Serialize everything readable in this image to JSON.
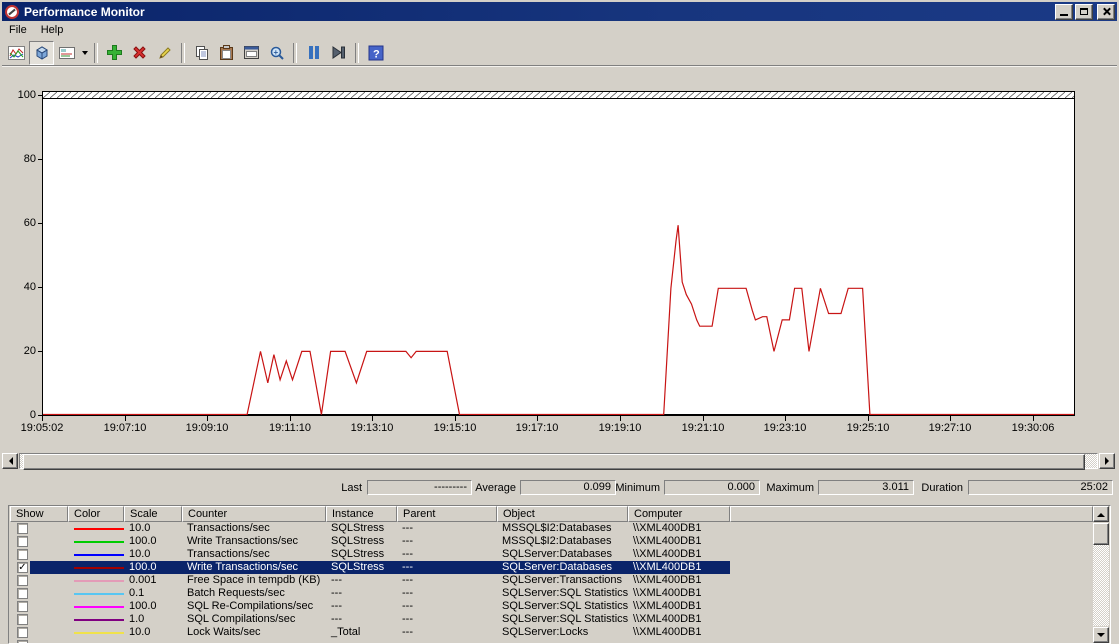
{
  "window": {
    "title": "Performance Monitor",
    "controls": {
      "minimize": "minimize",
      "maximize": "maximize",
      "close": "close"
    }
  },
  "menu": {
    "items": [
      {
        "label": "File"
      },
      {
        "label": "Help"
      }
    ]
  },
  "toolbar": {
    "items": [
      {
        "type": "button",
        "name": "view-current-activity",
        "icon": "chart"
      },
      {
        "type": "button",
        "name": "view-log-data",
        "icon": "cube",
        "pressed": true
      },
      {
        "type": "button",
        "name": "view-report",
        "icon": "report",
        "dropdown": true
      },
      {
        "type": "separator"
      },
      {
        "type": "button",
        "name": "add-counter",
        "icon": "add"
      },
      {
        "type": "button",
        "name": "delete-counter",
        "icon": "delete"
      },
      {
        "type": "button",
        "name": "highlight",
        "icon": "highlight"
      },
      {
        "type": "separator"
      },
      {
        "type": "button",
        "name": "copy-properties",
        "icon": "copy"
      },
      {
        "type": "button",
        "name": "paste-counter-list",
        "icon": "paste"
      },
      {
        "type": "button",
        "name": "properties",
        "icon": "properties"
      },
      {
        "type": "button",
        "name": "zoom",
        "icon": "zoom"
      },
      {
        "type": "separator"
      },
      {
        "type": "button",
        "name": "freeze-display",
        "icon": "pause"
      },
      {
        "type": "button",
        "name": "update-data",
        "icon": "step"
      },
      {
        "type": "separator"
      },
      {
        "type": "button",
        "name": "help",
        "icon": "help"
      }
    ]
  },
  "chart_data": {
    "type": "line",
    "ylim": [
      0,
      100
    ],
    "y_ticks": [
      "100",
      "80",
      "60",
      "40",
      "20",
      "0"
    ],
    "x_ticks": [
      "19:05:02",
      "19:07:10",
      "19:09:10",
      "19:11:10",
      "19:13:10",
      "19:15:10",
      "19:17:10",
      "19:19:10",
      "19:21:10",
      "19:23:10",
      "19:25:10",
      "19:27:10",
      "19:30:06"
    ],
    "grid": "off",
    "series": [
      {
        "name": "Write Transactions/sec",
        "color": "#C81414",
        "points": [
          [
            0,
            0
          ],
          [
            0.198,
            0
          ],
          [
            0.211,
            20
          ],
          [
            0.218,
            10
          ],
          [
            0.224,
            19
          ],
          [
            0.23,
            11
          ],
          [
            0.236,
            17
          ],
          [
            0.242,
            11
          ],
          [
            0.251,
            20
          ],
          [
            0.259,
            20
          ],
          [
            0.27,
            0
          ],
          [
            0.279,
            20
          ],
          [
            0.293,
            20
          ],
          [
            0.304,
            10
          ],
          [
            0.314,
            20
          ],
          [
            0.352,
            20
          ],
          [
            0.357,
            18
          ],
          [
            0.362,
            20
          ],
          [
            0.392,
            20
          ],
          [
            0.404,
            0
          ],
          [
            0.602,
            0
          ],
          [
            0.609,
            40
          ],
          [
            0.614,
            55
          ],
          [
            0.616,
            60
          ],
          [
            0.62,
            42
          ],
          [
            0.624,
            38
          ],
          [
            0.629,
            35
          ],
          [
            0.634,
            30
          ],
          [
            0.637,
            28
          ],
          [
            0.649,
            28
          ],
          [
            0.655,
            40
          ],
          [
            0.682,
            40
          ],
          [
            0.688,
            33
          ],
          [
            0.691,
            30
          ],
          [
            0.698,
            31
          ],
          [
            0.702,
            31
          ],
          [
            0.709,
            20
          ],
          [
            0.717,
            30
          ],
          [
            0.724,
            30
          ],
          [
            0.729,
            40
          ],
          [
            0.736,
            40
          ],
          [
            0.743,
            20
          ],
          [
            0.754,
            40
          ],
          [
            0.762,
            32
          ],
          [
            0.774,
            32
          ],
          [
            0.781,
            40
          ],
          [
            0.795,
            40
          ],
          [
            0.802,
            0
          ],
          [
            1,
            0
          ]
        ]
      }
    ]
  },
  "stats": {
    "last_label": "Last",
    "last_value": "---------",
    "average_label": "Average",
    "average_value": "0.099",
    "minimum_label": "Minimum",
    "minimum_value": "0.000",
    "maximum_label": "Maximum",
    "maximum_value": "3.011",
    "duration_label": "Duration",
    "duration_value": "25:02"
  },
  "table": {
    "headers": [
      "Show",
      "Color",
      "Scale",
      "Counter",
      "Instance",
      "Parent",
      "Object",
      "Computer"
    ],
    "rows": [
      {
        "show": false,
        "color": "#FF0000",
        "scale": "10.0",
        "counter": "Transactions/sec",
        "instance": "SQLStress",
        "parent": "---",
        "object": "MSSQL$I2:Databases",
        "computer": "\\\\XML400DB1",
        "selected": false
      },
      {
        "show": false,
        "color": "#00CC00",
        "scale": "100.0",
        "counter": "Write Transactions/sec",
        "instance": "SQLStress",
        "parent": "---",
        "object": "MSSQL$I2:Databases",
        "computer": "\\\\XML400DB1",
        "selected": false
      },
      {
        "show": false,
        "color": "#0000FF",
        "scale": "10.0",
        "counter": "Transactions/sec",
        "instance": "SQLStress",
        "parent": "---",
        "object": "SQLServer:Databases",
        "computer": "\\\\XML400DB1",
        "selected": false
      },
      {
        "show": true,
        "color": "#A00000",
        "scale": "100.0",
        "counter": "Write Transactions/sec",
        "instance": "SQLStress",
        "parent": "---",
        "object": "SQLServer:Databases",
        "computer": "\\\\XML400DB1",
        "selected": true
      },
      {
        "show": false,
        "color": "#E39BB7",
        "scale": "0.001",
        "counter": "Free Space in tempdb (KB)",
        "instance": "---",
        "parent": "---",
        "object": "SQLServer:Transactions",
        "computer": "\\\\XML400DB1",
        "selected": false
      },
      {
        "show": false,
        "color": "#58C6F2",
        "scale": "0.1",
        "counter": "Batch Requests/sec",
        "instance": "---",
        "parent": "---",
        "object": "SQLServer:SQL Statistics",
        "computer": "\\\\XML400DB1",
        "selected": false
      },
      {
        "show": false,
        "color": "#FF00FF",
        "scale": "100.0",
        "counter": "SQL Re-Compilations/sec",
        "instance": "---",
        "parent": "---",
        "object": "SQLServer:SQL Statistics",
        "computer": "\\\\XML400DB1",
        "selected": false
      },
      {
        "show": false,
        "color": "#800080",
        "scale": "1.0",
        "counter": "SQL Compilations/sec",
        "instance": "---",
        "parent": "---",
        "object": "SQLServer:SQL Statistics",
        "computer": "\\\\XML400DB1",
        "selected": false
      },
      {
        "show": false,
        "color": "#F0E24B",
        "scale": "10.0",
        "counter": "Lock Waits/sec",
        "instance": "_Total",
        "parent": "---",
        "object": "SQLServer:Locks",
        "computer": "\\\\XML400DB1",
        "selected": false
      },
      {
        "show": false,
        "color": "",
        "scale": "",
        "counter": "",
        "instance": "",
        "parent": "",
        "object": "",
        "computer": "",
        "selected": false
      }
    ]
  },
  "colors": {
    "titlebar": "#0A246A",
    "selection": "#0A246A",
    "chrome": "#D4D0C8",
    "plot_line": "#C81414",
    "plot_bg": "#FFFFFF"
  }
}
